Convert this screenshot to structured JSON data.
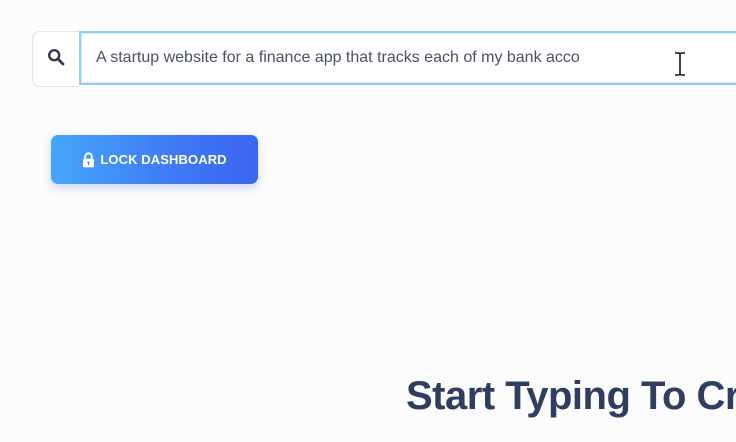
{
  "search": {
    "icon": "search-icon",
    "value": "A startup website for a finance app that tracks each of my bank acco"
  },
  "lock_button": {
    "icon": "lock-icon",
    "label": "LOCK DASHBOARD"
  },
  "hero": {
    "title": "Start Typing To Cr"
  },
  "colors": {
    "accent_start": "#45a7f9",
    "accent_end": "#3b66f0",
    "title": "#2f3e5e",
    "input_focus_border": "#8fd0ec"
  }
}
